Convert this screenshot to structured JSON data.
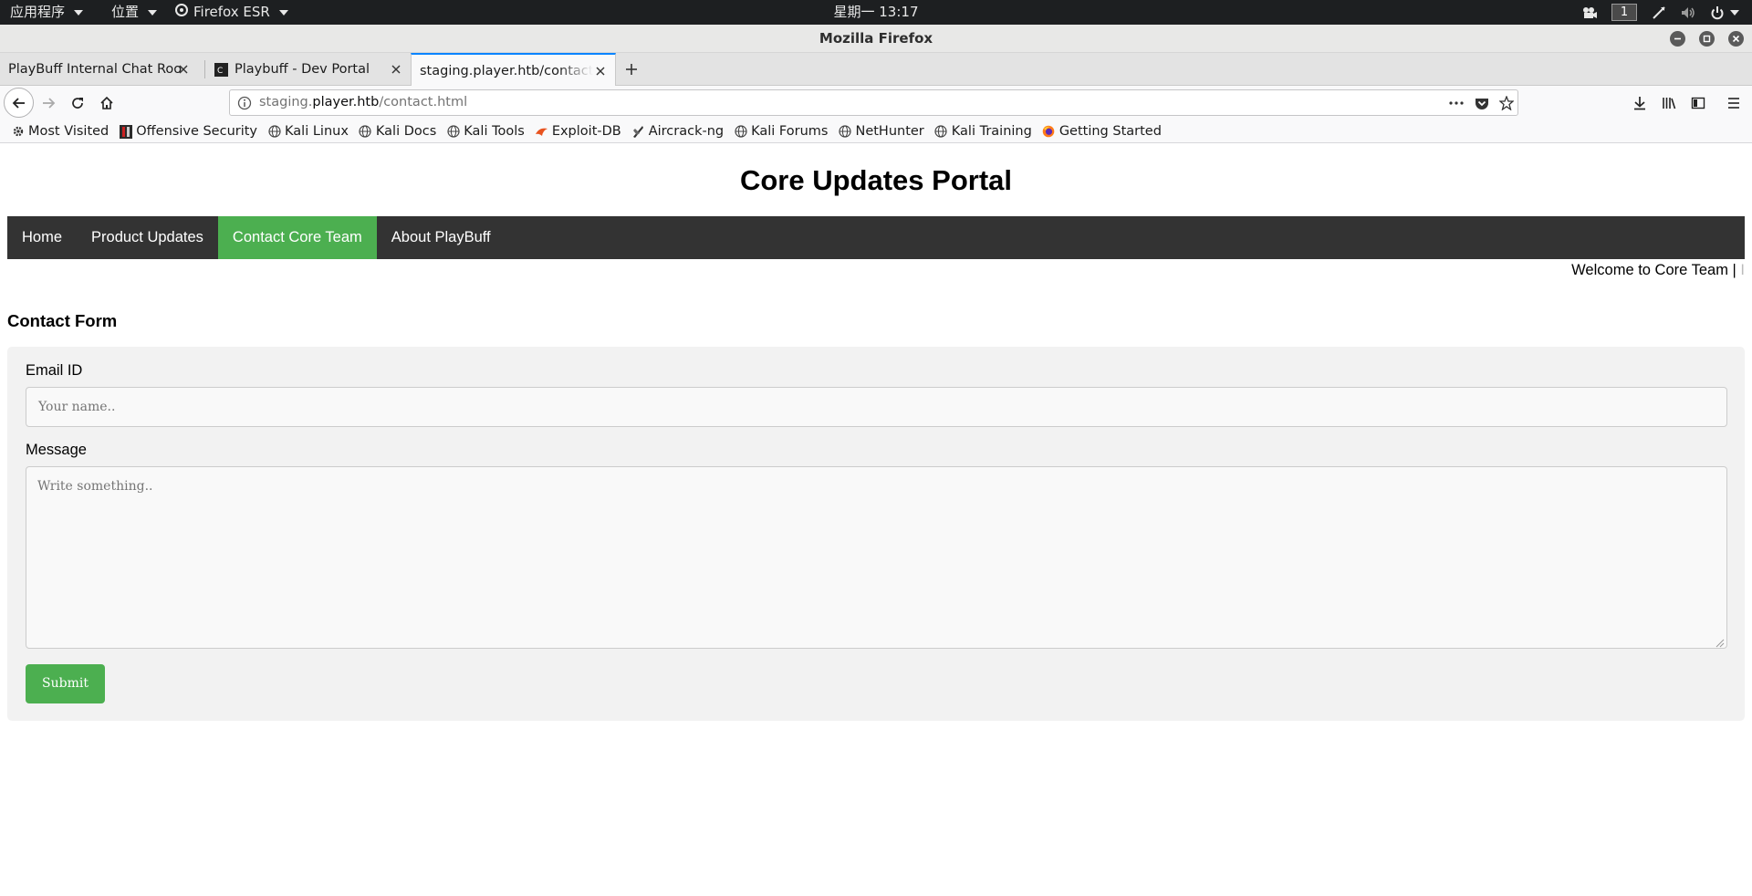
{
  "system_bar": {
    "apps_menu": "应用程序",
    "places_menu": "位置",
    "browser_menu": "Firefox ESR",
    "clock": "星期一 13:17",
    "workspace": "1"
  },
  "window": {
    "title": "Mozilla Firefox"
  },
  "tabs": [
    {
      "label": "PlayBuff Internal Chat Room"
    },
    {
      "label": "Playbuff - Dev Portal"
    },
    {
      "label": "staging.player.htb/contact.html"
    }
  ],
  "address_bar": {
    "url_prefix": "staging.",
    "url_host": "player.htb",
    "url_path": "/contact.html"
  },
  "bookmarks": [
    {
      "label": "Most Visited",
      "icon": "gear-icon"
    },
    {
      "label": "Offensive Security",
      "icon": "offsec-icon"
    },
    {
      "label": "Kali Linux",
      "icon": "globe-icon"
    },
    {
      "label": "Kali Docs",
      "icon": "globe-icon"
    },
    {
      "label": "Kali Tools",
      "icon": "globe-icon"
    },
    {
      "label": "Exploit-DB",
      "icon": "exploitdb-icon"
    },
    {
      "label": "Aircrack-ng",
      "icon": "aircrack-icon"
    },
    {
      "label": "Kali Forums",
      "icon": "globe-icon"
    },
    {
      "label": "NetHunter",
      "icon": "globe-icon"
    },
    {
      "label": "Kali Training",
      "icon": "globe-icon"
    },
    {
      "label": "Getting Started",
      "icon": "firefox-icon"
    }
  ],
  "page": {
    "title": "Core Updates Portal",
    "nav": [
      {
        "label": "Home",
        "active": false
      },
      {
        "label": "Product Updates",
        "active": false
      },
      {
        "label": "Contact Core Team",
        "active": true
      },
      {
        "label": "About PlayBuff",
        "active": false
      }
    ],
    "welcome": "Welcome to Core Team | ",
    "welcome_cursor": "I",
    "form": {
      "heading": "Contact Form",
      "email_label": "Email ID",
      "email_placeholder": "Your name..",
      "message_label": "Message",
      "message_placeholder": "Write something..",
      "submit_label": "Submit"
    }
  },
  "colors": {
    "nav_background": "#333333",
    "nav_active": "#4caf50",
    "submit_background": "#4caf50",
    "form_background": "#f2f2f2",
    "tab_active_border": "#0a84ff"
  }
}
